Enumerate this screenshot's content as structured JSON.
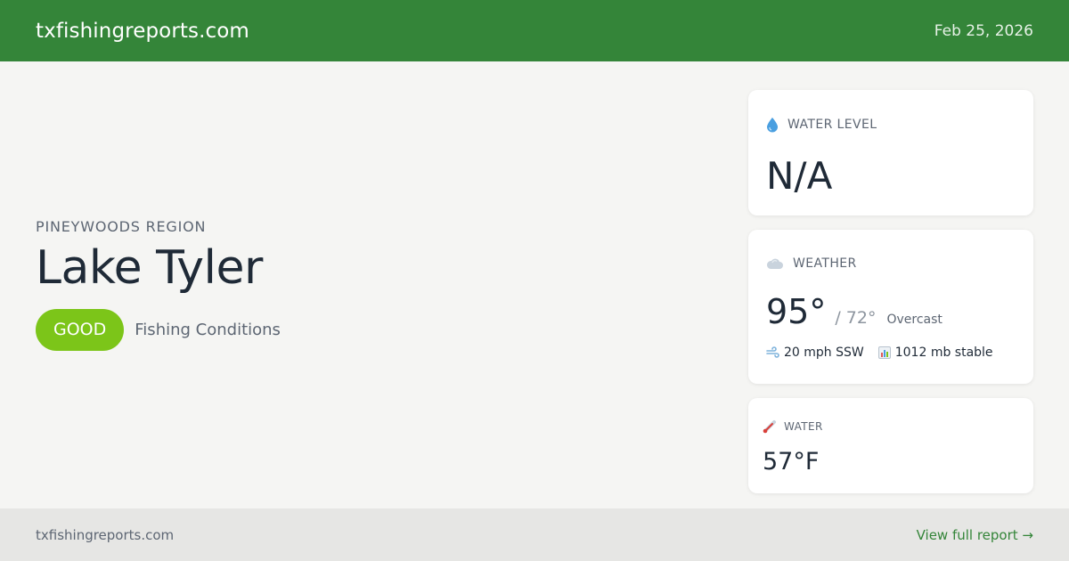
{
  "header": {
    "brand": "txfishingreports.com",
    "date": "Feb 25, 2026"
  },
  "lake": {
    "region": "PINEYWOODS REGION",
    "name": "Lake Tyler",
    "rating": "GOOD",
    "rating_label": "Fishing Conditions"
  },
  "water_level": {
    "label": "WATER LEVEL",
    "value": "N/A",
    "icon": "water-drop-icon"
  },
  "weather": {
    "label": "WEATHER",
    "icon": "cloud-icon",
    "high": "95°",
    "low": "/ 72°",
    "condition": "Overcast",
    "wind": "20 mph SSW",
    "pressure": "1012 mb stable"
  },
  "water_temp": {
    "label": "WATER",
    "value": "57°F",
    "icon": "thermometer-icon"
  },
  "footer": {
    "brand": "txfishingreports.com",
    "link": "View full report →"
  },
  "colors": {
    "header_bg": "#348539",
    "badge_bg": "#7cc519",
    "link": "#348539",
    "page_bg": "#f5f5f3",
    "footer_bg": "#e6e6e4"
  }
}
